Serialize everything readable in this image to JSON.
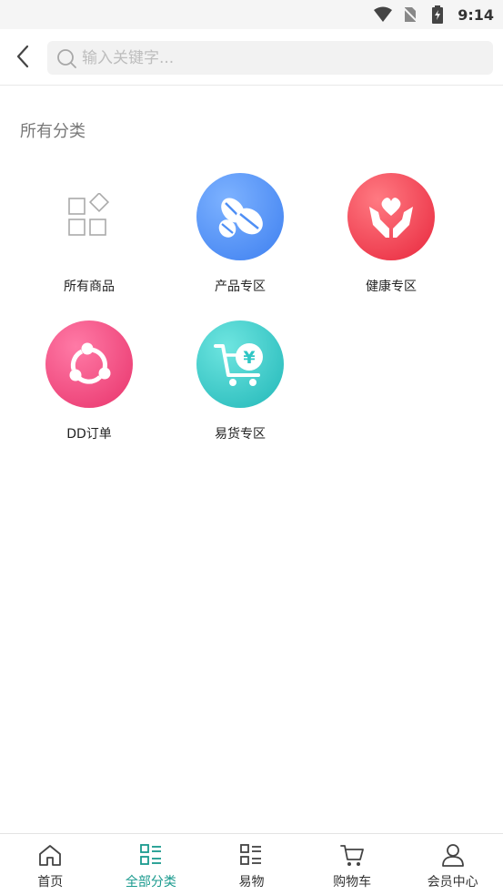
{
  "status_bar": {
    "time": "9:14"
  },
  "header": {
    "search_placeholder": "输入关键字..."
  },
  "section": {
    "title": "所有分类"
  },
  "categories": [
    {
      "label": "所有商品",
      "icon": "grid-icon"
    },
    {
      "label": "产品专区",
      "icon": "coffee-beans-icon",
      "color": "#4f8ff5"
    },
    {
      "label": "健康专区",
      "icon": "heart-hands-icon",
      "color": "#f0384a"
    },
    {
      "label": "DD订单",
      "icon": "share-nodes-icon",
      "color": "#f0457a"
    },
    {
      "label": "易货专区",
      "icon": "cart-yen-icon",
      "color": "#2ec6c4"
    }
  ],
  "bottom_nav": {
    "active_color": "#1a9a8e",
    "items": [
      {
        "label": "首页",
        "icon": "home-icon"
      },
      {
        "label": "全部分类",
        "icon": "category-list-icon",
        "active": true
      },
      {
        "label": "易物",
        "icon": "list-icon"
      },
      {
        "label": "购物车",
        "icon": "cart-icon"
      },
      {
        "label": "会员中心",
        "icon": "user-icon"
      }
    ]
  }
}
